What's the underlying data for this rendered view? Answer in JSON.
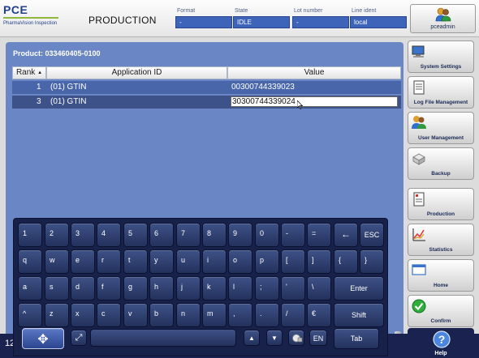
{
  "brand": {
    "name": "PCE",
    "tagline": "PharmaVision Inspection"
  },
  "header": {
    "title": "PRODUCTION",
    "fields": [
      {
        "label": "Format",
        "value": "-"
      },
      {
        "label": "State",
        "value": "IDLE"
      },
      {
        "label": "Lot number",
        "value": "-"
      },
      {
        "label": "Line ident",
        "value": "local"
      }
    ],
    "user": {
      "name": "pceadmin"
    }
  },
  "product_line": "Product: 033460405-0100",
  "grid": {
    "headers": {
      "rank": "Rank",
      "rank_sort": "▲",
      "app_id": "Application ID",
      "value": "Value"
    },
    "rows": [
      {
        "rank": "1",
        "app_id": "(01) GTIN",
        "value": "00300744339023",
        "selected": false
      },
      {
        "rank": "3",
        "app_id": "(01) GTIN",
        "value": "30300744339024",
        "selected": true,
        "editing": true
      }
    ]
  },
  "keyboard": {
    "row1": [
      "1",
      "2",
      "3",
      "4",
      "5",
      "6",
      "7",
      "8",
      "9",
      "0",
      "-",
      "=",
      "←",
      "ESC"
    ],
    "row2": [
      "q",
      "w",
      "e",
      "r",
      "t",
      "y",
      "u",
      "i",
      "o",
      "p",
      "[",
      "]",
      "{",
      "}"
    ],
    "row3": [
      "a",
      "s",
      "d",
      "f",
      "g",
      "h",
      "j",
      "k",
      "l",
      ";",
      "'",
      "\\",
      "Enter"
    ],
    "row4": [
      "^",
      "z",
      "x",
      "c",
      "v",
      "b",
      "n",
      "m",
      ",",
      ".",
      "/",
      "€",
      "Shift"
    ],
    "bottom": {
      "move": "✥",
      "resize": "⤢",
      "up": "▲",
      "down": "▼",
      "lang": "EN",
      "tab": "Tab"
    }
  },
  "bottom_strip": {
    "text": "12"
  },
  "sidebar": [
    {
      "label": "System Settings",
      "icon": "computer-icon"
    },
    {
      "label": "Log File Management",
      "icon": "log-file-icon"
    },
    {
      "label": "User Management",
      "icon": "users-icon"
    },
    {
      "label": "Backup",
      "icon": "backup-icon"
    },
    {
      "label": "Production",
      "icon": "production-icon"
    },
    {
      "label": "Statistics",
      "icon": "statistics-icon"
    },
    {
      "label": "Home",
      "icon": "home-icon"
    },
    {
      "label": "Confirm",
      "icon": "confirm-icon"
    }
  ],
  "help": {
    "label": "Help",
    "icon": "help-icon"
  },
  "colors": {
    "panel": "#6a86c4",
    "accent": "#3e64b9",
    "keyboard": "#18214a",
    "brand": "#1f3f8f",
    "brand_rule": "#8fb93a"
  }
}
